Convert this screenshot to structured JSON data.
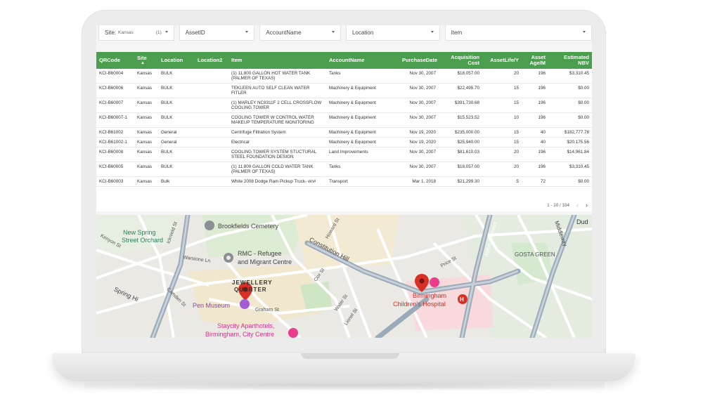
{
  "filters": {
    "site": {
      "label": "Site:",
      "value": "Kansas",
      "count": "(1)"
    },
    "asset_id": {
      "label": "AssetID"
    },
    "account_name": {
      "label": "AccountName"
    },
    "location": {
      "label": "Location"
    },
    "item": {
      "label": "Item"
    }
  },
  "table": {
    "headers": {
      "qrcode": "QRCode",
      "site": "Site",
      "location": "Location",
      "location2": "Location2",
      "item": "Item",
      "account_name": "AccountName",
      "purchase_date": "PurchaseDate",
      "acq_cost_1": "Acquisition",
      "acq_cost_2": "Cost",
      "asset_life": "AssetLife/Y",
      "asset_age_1": "Asset",
      "asset_age_2": "Age/M",
      "nbv_1": "Estimated",
      "nbv_2": "NBV"
    },
    "rows": [
      {
        "qr": "KCI-B60004",
        "site": "Kansas",
        "loc": "BULK",
        "loc2": "",
        "item": "(1) 11,800 GALLON HOT WATER TANK (PALMER OF TEXAS)",
        "acct": "Tanks",
        "date": "Nov 30, 2007",
        "cost": "$18,057.00",
        "life": "20",
        "age": "196",
        "nbv": "$3,310.45"
      },
      {
        "qr": "KCI-B60006",
        "site": "Kansas",
        "loc": "BULK",
        "loc2": "",
        "item": "TEKLEEN AUTO SELF CLEAN WATER FITLER",
        "acct": "Machinery & Equipment",
        "date": "Nov 30, 2007",
        "cost": "$22,495.70",
        "life": "15",
        "age": "196",
        "nbv": "$0.00"
      },
      {
        "qr": "KCI-B60007",
        "site": "Kansas",
        "loc": "BULK",
        "loc2": "",
        "item": "(1) MARLEY NC8311F 2 CELL CROSSFLOW COOLING TOWER",
        "acct": "Machinery & Equipment",
        "date": "Nov 30, 2007",
        "cost": "$391,730.68",
        "life": "15",
        "age": "196",
        "nbv": "$0.00"
      },
      {
        "qr": "KCI-B60007-1",
        "site": "Kansas",
        "loc": "BULK",
        "loc2": "",
        "item": "COOLING TOWER W CONTROL WATER MAKEUP TEMPERATURE MONITORING",
        "acct": "Machinery & Equipment",
        "date": "Nov 30, 2007",
        "cost": "$15,523.52",
        "life": "10",
        "age": "196",
        "nbv": "$0.00"
      },
      {
        "qr": "KCI-B61002",
        "site": "Kansas",
        "loc": "General",
        "loc2": "",
        "item": "Centrifuge Filtration System",
        "acct": "Machinery & Equipment",
        "date": "Nov 19, 2020",
        "cost": "$235,000.00",
        "life": "15",
        "age": "40",
        "nbv": "$182,777.78"
      },
      {
        "qr": "KCI-B61002-1",
        "site": "Kansas",
        "loc": "General",
        "loc2": "",
        "item": "Electrical",
        "acct": "Machinery & Equipment",
        "date": "Nov 19, 2020",
        "cost": "$25,940.00",
        "life": "15",
        "age": "40",
        "nbv": "$20,175.56"
      },
      {
        "qr": "KCI-B60008",
        "site": "Kansas",
        "loc": "BULK",
        "loc2": "",
        "item": "COOLING TOWER SYSTEM STUCTURAL STEEL FOUNDATION DESIGN",
        "acct": "Land Improvements",
        "date": "Nov 30, 2007",
        "cost": "$81,610.03",
        "life": "20",
        "age": "196",
        "nbv": "$14,961.84"
      },
      {
        "qr": "KCI-B60005",
        "site": "Kansas",
        "loc": "BULK",
        "loc2": "",
        "item": "(1) 11,800 GALLON COLD WATER TANK (PALMER OF TEXAS)",
        "acct": "Tanks",
        "date": "Nov 30, 2007",
        "cost": "$18,057.00",
        "life": "20",
        "age": "196",
        "nbv": "$3,310.45"
      },
      {
        "qr": "KCI-B60003",
        "site": "Kansas",
        "loc": "Bulk",
        "loc2": "",
        "item": "White 2008 Dodge Ram Pickup Truck- vin#",
        "acct": "Transport",
        "date": "Mar 1, 2018",
        "cost": "$21,299.30",
        "life": "5",
        "age": "72",
        "nbv": "$0.00"
      }
    ],
    "pagination": "1 - 10 / 334"
  },
  "map": {
    "labels": {
      "kenyon": "Kenyon St",
      "new_spring": "New Spring",
      "street_orchard": "Street Orchard",
      "icknield": "Icknield St",
      "brookfields": "Brookfields Cemetery",
      "howard": "Howard St",
      "constitution": "Constitution Hill",
      "rmc1": "RMC - Refugee",
      "rmc2": "and Migrant Centre",
      "warstone": "Warstone Ln",
      "jewellery1": "JEWELLERY",
      "jewellery2": "QUARTER",
      "pen_museum": "Pen Museum",
      "graham": "Graham St",
      "staycity1": "Staycity Aparthotels,",
      "staycity2": "Birmingham, City Centre",
      "spring_hill": "Spring Hi",
      "camden": "Camden St",
      "cox": "Cox St",
      "water": "Water St",
      "lionel": "Lionel St",
      "price": "Price St",
      "aston": "Aston Express",
      "gosta": "GOSTA GREEN",
      "middleway": "Middleway",
      "dud": "Dud",
      "bch1": "Birmingham",
      "bch2": "Children's Hospital"
    }
  }
}
